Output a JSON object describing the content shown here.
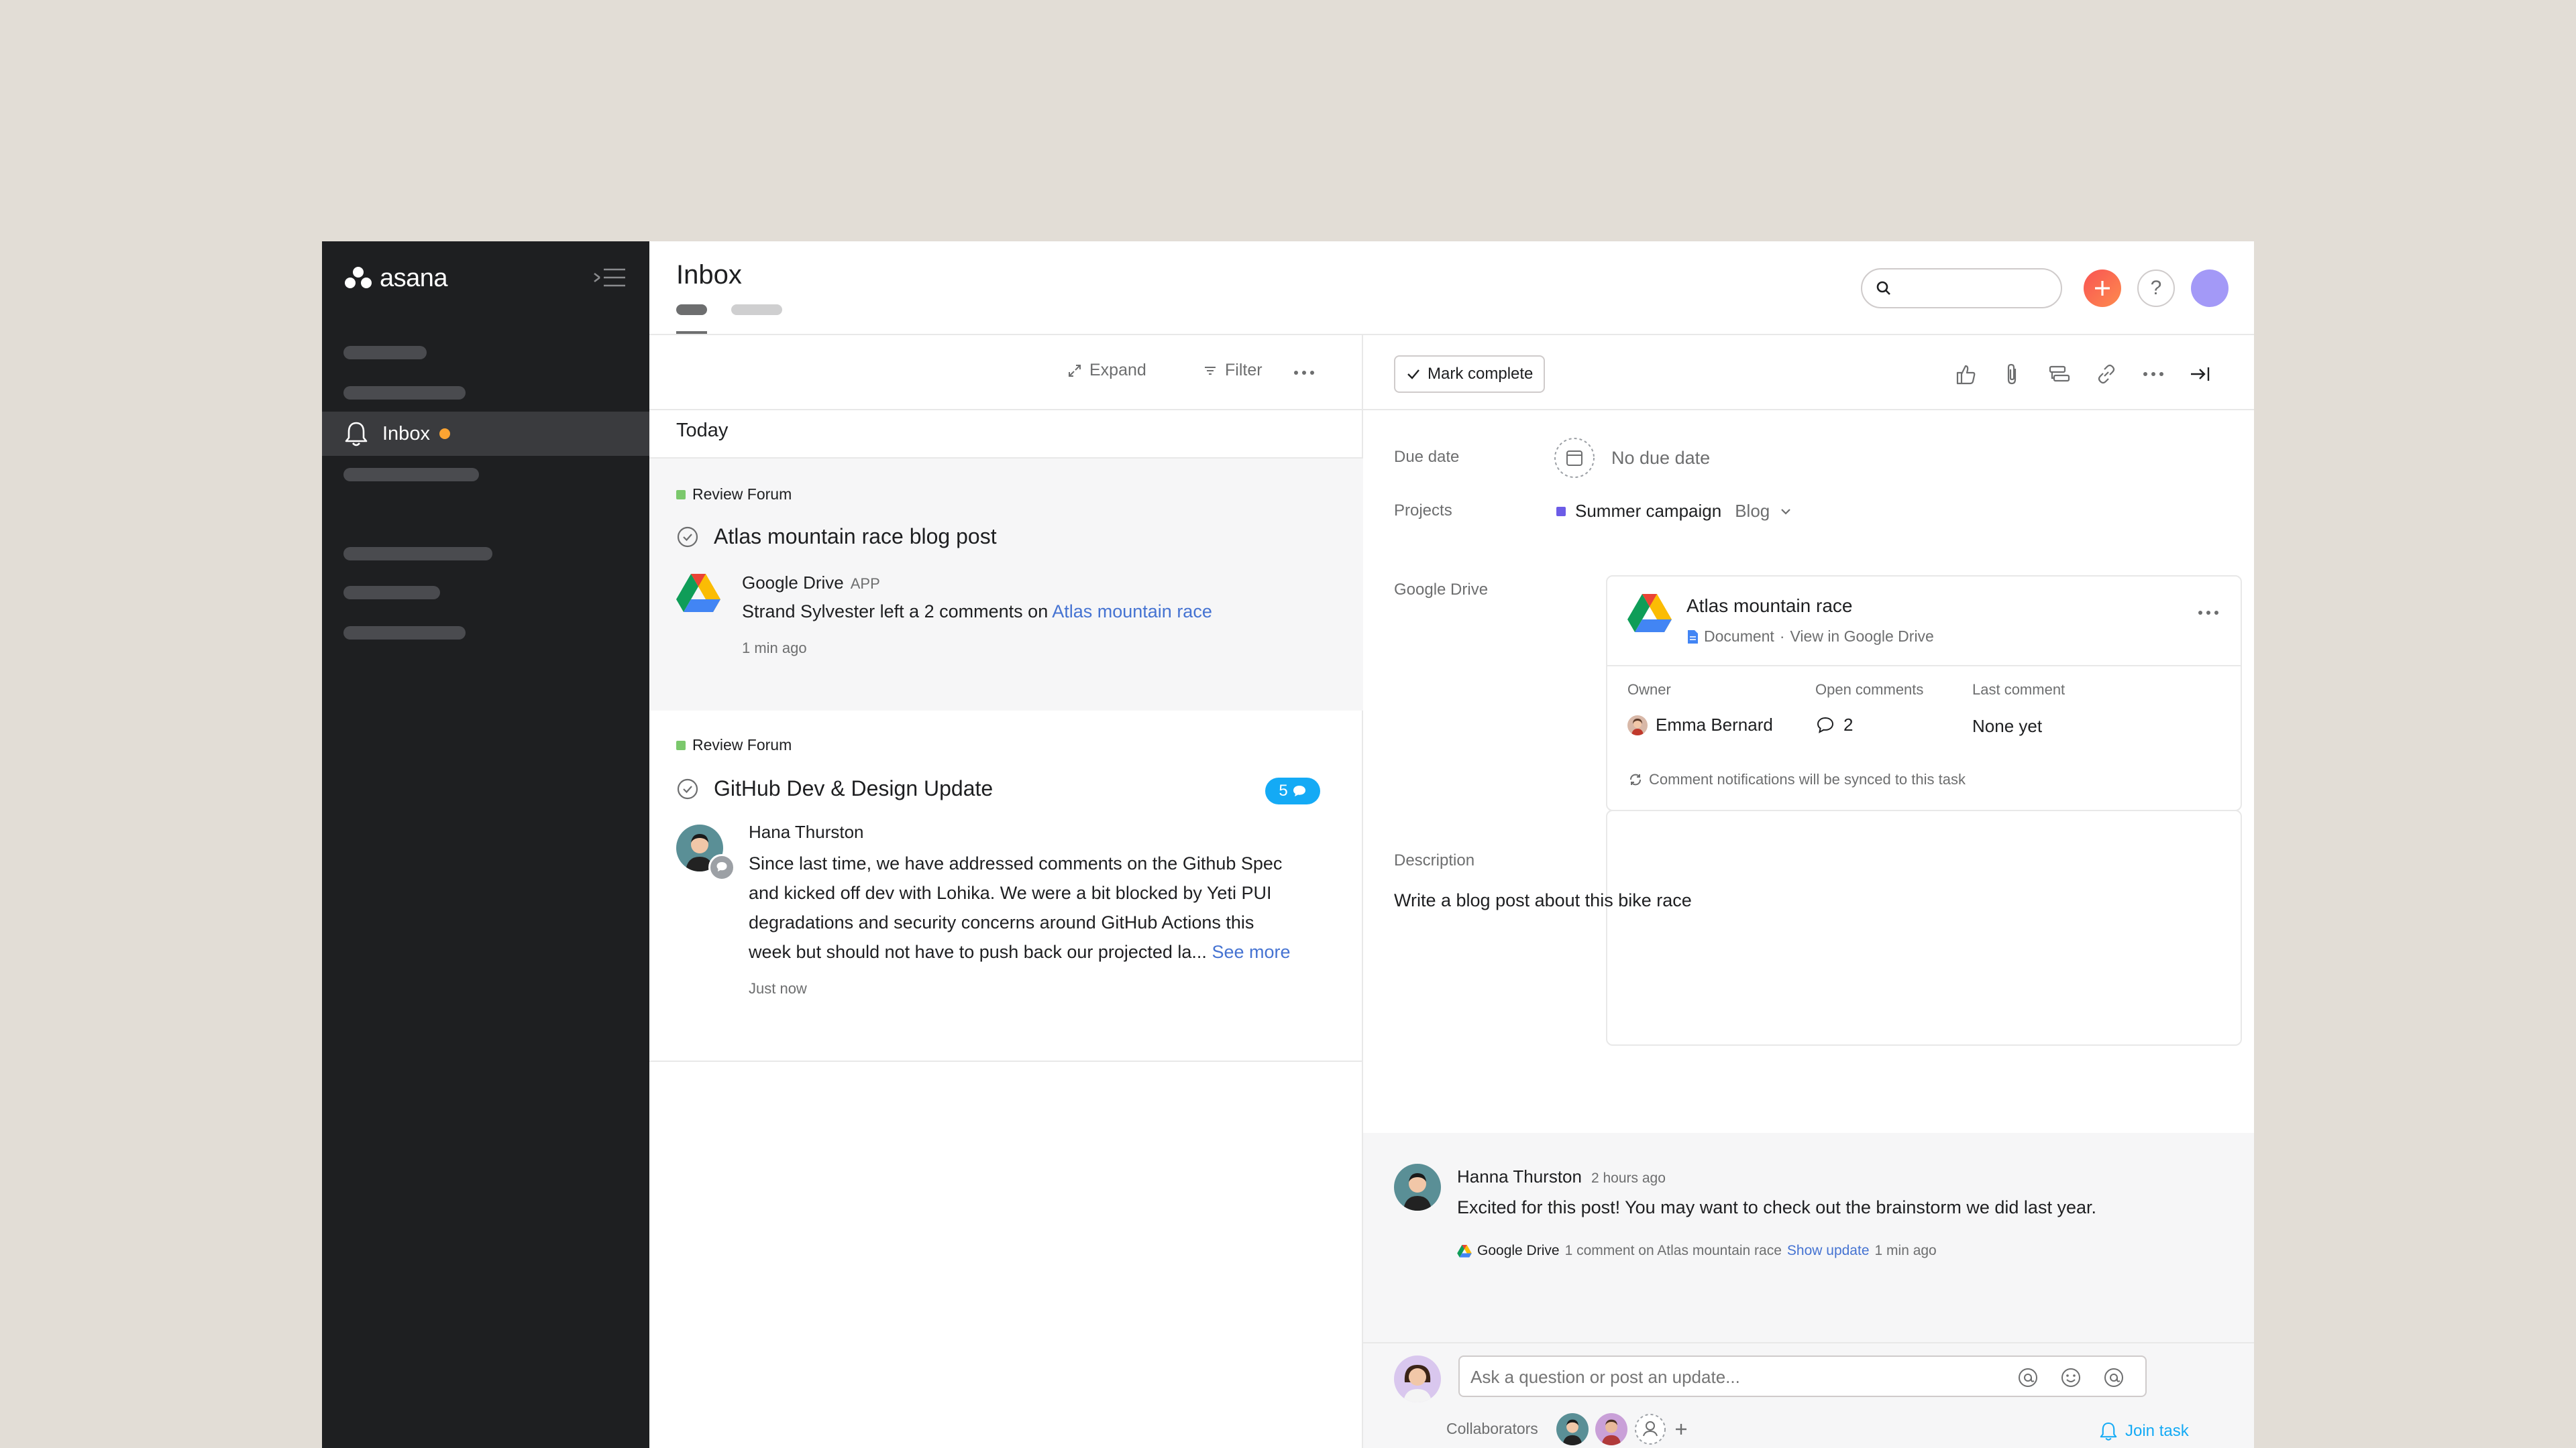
{
  "app": {
    "logo_text": "asana"
  },
  "sidebar": {
    "active_item": {
      "label": "Inbox"
    }
  },
  "header": {
    "title": "Inbox"
  },
  "list": {
    "toolbar": {
      "expand": "Expand",
      "filter": "Filter"
    },
    "section": "Today",
    "items": [
      {
        "project": "Review Forum",
        "title": "Atlas mountain race blog post",
        "actor": "Google Drive",
        "actor_tag": "APP",
        "text_prefix": "Strand Sylvester left a 2 comments on ",
        "text_link": "Atlas mountain race",
        "time": "1 min ago"
      },
      {
        "project": "Review Forum",
        "title": "GitHub Dev & Design Update",
        "badge_count": "5",
        "actor": "Hana Thurston",
        "lines": [
          "Since last time, we have addressed comments on the Github Spec",
          "and kicked off dev with Lohika. We were a bit blocked by Yeti PUI",
          "degradations and security concerns around GitHub Actions this",
          "week but should not have to push back our projected la... "
        ],
        "see_more": "See more",
        "time": "Just now"
      }
    ]
  },
  "detail": {
    "mark_complete": "Mark complete",
    "due_date_label": "Due date",
    "due_date_value": "No due date",
    "projects_label": "Projects",
    "project_name": "Summer campaign",
    "project_section": "Blog",
    "gdrive_label": "Google Drive",
    "gdrive": {
      "title": "Atlas mountain race",
      "doc_type": "Document",
      "view_link": "View in Google Drive",
      "owner_label": "Owner",
      "owner_value": "Emma Bernard",
      "open_comments_label": "Open comments",
      "open_comments_value": "2",
      "last_comment_label": "Last comment",
      "last_comment_value": "None yet",
      "sync_note": "Comment notifications will be synced to this task"
    },
    "description_label": "Description",
    "description_value": "Write a blog post about this bike race",
    "comment": {
      "author": "Hanna Thurston",
      "time": "2 hours ago",
      "text": "Excited for this post! You may want to check out the brainstorm we did last year.",
      "sub_source": "Google Drive",
      "sub_text": "1 comment on Atlas mountain race",
      "sub_link": "Show update",
      "sub_time": "1 min ago"
    },
    "composer_placeholder": "Ask a question or post an update...",
    "collaborators_label": "Collaborators",
    "join_task": "Join task"
  },
  "colors": {
    "sidebar_bg": "#1e1f21",
    "accent_link": "#4573d2",
    "badge": "#14aaf5",
    "notification_dot": "#fca432",
    "project_tag": "#7bc86c",
    "summer_campaign": "#6c5ce7"
  },
  "icons": [
    "bell-icon",
    "collapse-sidebar-icon",
    "search-icon",
    "plus-icon",
    "help-icon",
    "expand-icon",
    "filter-icon",
    "more-icon",
    "check-icon",
    "thumbs-up-icon",
    "attachment-icon",
    "subtask-icon",
    "link-icon",
    "close-panel-icon",
    "calendar-icon",
    "chevron-down-icon",
    "google-drive-icon",
    "document-icon",
    "comment-icon",
    "sync-icon",
    "mention-icon",
    "emoji-icon"
  ]
}
